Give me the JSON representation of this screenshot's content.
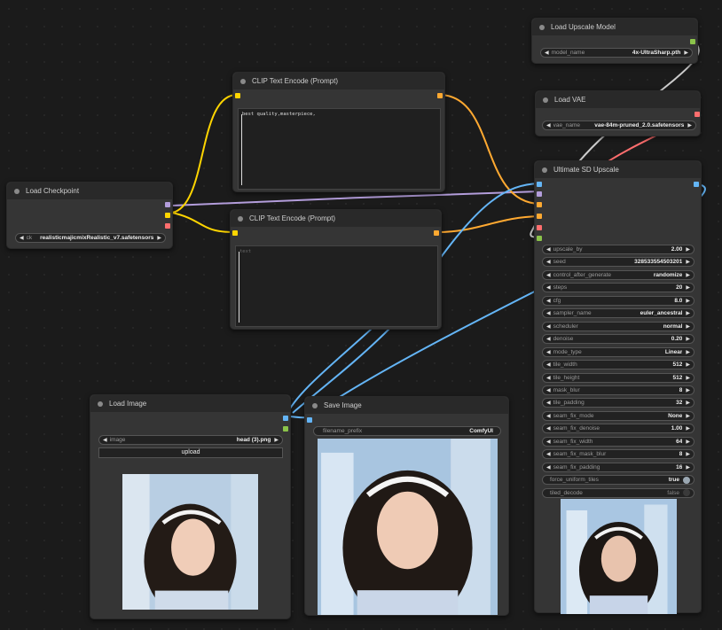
{
  "nodes": {
    "load_upscale_model": {
      "title": "Load Upscale Model",
      "model_name": {
        "label": "model_name",
        "value": "4x-UltraSharp.pth"
      }
    },
    "load_vae": {
      "title": "Load VAE",
      "vae_name": {
        "label": "vae_name",
        "value": "vae-84m-pruned_2.0.safetensors"
      }
    },
    "clip_top": {
      "title": "CLIP Text Encode (Prompt)",
      "text": "best quality,masterpiece,"
    },
    "clip_bottom": {
      "title": "CLIP Text Encode (Prompt)",
      "text": "text"
    },
    "load_checkpoint": {
      "title": "Load Checkpoint",
      "ckpt_name": {
        "label": "ckpt_name",
        "value": "realisticmajicmixRealistic_v7.safetensors"
      }
    },
    "load_image": {
      "title": "Load Image",
      "image": {
        "label": "image",
        "value": "head (3).png"
      },
      "upload_label": "upload"
    },
    "save_image": {
      "title": "Save Image",
      "filename_prefix": {
        "label": "filename_prefix",
        "value": "ComfyUI"
      }
    },
    "ultimate_sd_upscale": {
      "title": "Ultimate SD Upscale",
      "widgets": [
        {
          "label": "upscale_by",
          "value": "2.00"
        },
        {
          "label": "seed",
          "value": "328533554503201"
        },
        {
          "label": "control_after_generate",
          "value": "randomize"
        },
        {
          "label": "steps",
          "value": "20"
        },
        {
          "label": "cfg",
          "value": "8.0"
        },
        {
          "label": "sampler_name",
          "value": "euler_ancestral"
        },
        {
          "label": "scheduler",
          "value": "normal"
        },
        {
          "label": "denoise",
          "value": "0.20"
        },
        {
          "label": "mode_type",
          "value": "Linear"
        },
        {
          "label": "tile_width",
          "value": "512"
        },
        {
          "label": "tile_height",
          "value": "512"
        },
        {
          "label": "mask_blur",
          "value": "8"
        },
        {
          "label": "tile_padding",
          "value": "32"
        },
        {
          "label": "seam_fix_mode",
          "value": "None"
        },
        {
          "label": "seam_fix_denoise",
          "value": "1.00"
        },
        {
          "label": "seam_fix_width",
          "value": "64"
        },
        {
          "label": "seam_fix_mask_blur",
          "value": "8"
        },
        {
          "label": "seam_fix_padding",
          "value": "16"
        }
      ],
      "toggles": [
        {
          "label": "force_uniform_tiles",
          "value": "true",
          "on": true
        },
        {
          "label": "tiled_decode",
          "value": "false",
          "on": false
        }
      ]
    }
  },
  "colors": {
    "model": "#b39ddb",
    "clip": "#ffd500",
    "vae": "#ff6e6e",
    "conditioning": "#ffa931",
    "image": "#64b5f6",
    "upscale_model": "#8bc34a",
    "link_gray": "#cccccc",
    "canvas": "#1b1b1b",
    "node": "#353535"
  }
}
